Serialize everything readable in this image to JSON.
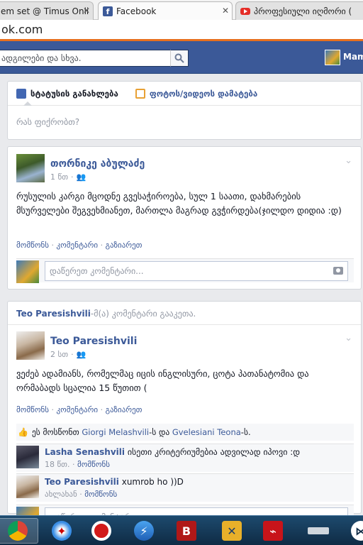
{
  "browser": {
    "tabs": [
      {
        "title": "em set @ Timus Onli",
        "icon": "page-icon"
      },
      {
        "title": "Facebook",
        "icon": "facebook-icon"
      },
      {
        "title": "პროფესიული იღმორი (",
        "icon": "youtube-icon"
      }
    ],
    "url": "ok.com"
  },
  "topbar": {
    "search_placeholder": "ადგილები და სხვა.",
    "user_name": "Mam"
  },
  "composer": {
    "status_label": "სტატუსის განახლება",
    "photo_label": "ფოტოს/ვიდეოს დამატება",
    "prompt": "რას ფიქრობთ?"
  },
  "post1": {
    "author": "თორნიკე აბულაძე",
    "time": "1 წთ",
    "text": "რუსულის კარგი მცოდნე გვესაჭიროება, სულ 1 საათი, დახმარების მსურველები შეგვეხმიანეთ, მართლა მაგრად გვჭირდება(ჯილდო დიდია :დ)",
    "actions": [
      "მომწონს",
      "კომენტარი",
      "გაზიარეთ"
    ],
    "comment_placeholder": "დაწერეთ კომენტარი..."
  },
  "post2": {
    "story_actor": "Teo Paresishvili",
    "story_suffix": "-მ(ა) კომენტარი გააკეთა.",
    "author": "Teo Paresishvili",
    "time": "2 სთ",
    "text": "ვეძებ ადამიანს, რომელმაც იცის ინგლისური, ცოტა პათანატომია და ორმაბადს სცალია 15 წუთით (",
    "actions": [
      "მომწონს",
      "კომენტარი",
      "გაზიარეთ"
    ],
    "likes_prefix": "ეს მოსწონთ",
    "likers": [
      "Giorgi Melashvili",
      "Gvelesiani Teona"
    ],
    "likes_mid": "-ს და",
    "likes_end": "-ს.",
    "comments": [
      {
        "author": "Lasha Senashvili",
        "text": "ისეთი კრიტერიუმებია ადვილად იპოვი :დ",
        "time": "18 წთ.",
        "like": "მომწონს"
      },
      {
        "author": "Teo Paresishvili",
        "text": "xumrob ho ))D",
        "time": "ახლახან",
        "like": "მომწონს"
      }
    ],
    "comment_placeholder": "დაწერეთ კომენტარი..."
  },
  "taskbar": {
    "apps": [
      "chrome-icon",
      "safari-icon",
      "opera-icon",
      "thunder-icon",
      "bitdefender-icon",
      "network-icon",
      "acrobat-icon",
      "blank-icon",
      "media-icon"
    ],
    "bitdefender_letter": "B"
  }
}
